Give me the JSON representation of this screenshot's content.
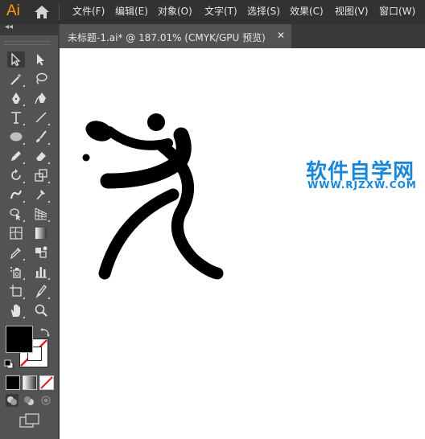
{
  "app": {
    "logo": "Ai"
  },
  "menu": [
    "文件(F)",
    "编辑(E)",
    "对象(O)",
    "文字(T)",
    "选择(S)",
    "效果(C)",
    "视图(V)",
    "窗口(W)"
  ],
  "document_tab": {
    "label": "未标题-1.ai* @ 187.01% (CMYK/GPU 预览)",
    "close": "✕"
  },
  "panel": {
    "collapse": "◂◂"
  },
  "watermark": {
    "title": "软件自学网",
    "url": "WWW.RJZXW.COM"
  },
  "colors": {
    "accent": "#ff9a00",
    "watermark": "#1a86d8",
    "menubar": "#323232",
    "panel": "#535353",
    "canvas": "#ffffff"
  },
  "tools": [
    "selection-tool",
    "direct-selection-tool",
    "magic-wand-tool",
    "lasso-tool",
    "pen-tool",
    "curvature-tool",
    "type-tool",
    "line-segment-tool",
    "ellipse-tool",
    "paintbrush-tool",
    "pencil-tool",
    "eraser-tool",
    "rotate-tool",
    "scale-tool",
    "warp-tool",
    "puppet-warp-tool",
    "shape-builder-tool",
    "perspective-grid-tool",
    "mesh-tool",
    "gradient-tool",
    "eyedropper-tool",
    "blend-tool",
    "symbol-sprayer-tool",
    "column-graph-tool",
    "artboard-tool",
    "slice-tool",
    "hand-tool",
    "zoom-tool"
  ]
}
